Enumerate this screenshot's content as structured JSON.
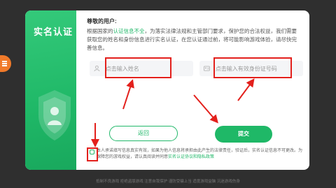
{
  "modal": {
    "panel_title": "实名认证",
    "greeting": "尊敬的用户:",
    "notice_pre": "根据国家的",
    "notice_highlight": "认证信息不全",
    "notice_post": "，为落实法律法规和主管部门要求，保护您的合法权益，我们需要获取您的姓名和身份信息进行实名认证，在您认证通过前，将可能影响游戏体验，请尽快完善信息。"
  },
  "form": {
    "name_placeholder": "点击输入姓名",
    "id_placeholder": "点击输入有效身份证号码"
  },
  "buttons": {
    "back_label": "返回",
    "submit_label": "提交"
  },
  "agreement": {
    "text": "本人承诺填写信息真实有效，如果为他人信息将承担由此产生的法律责任，验证后，实名认证信息不可更改。为保障您的游戏权益，请认真阅读并同意",
    "link": "实名认证协议和隐私政策"
  },
  "footer": {
    "text": "抵制不良游戏 拒绝盗版游戏 注意自我保护 谨防受骗上当 适度游戏益脑 沉迷游戏伤身"
  },
  "colors": {
    "brand_green": "#1fb867",
    "annotation_red": "#e3201c",
    "side_toggle": "#f07a2a"
  }
}
